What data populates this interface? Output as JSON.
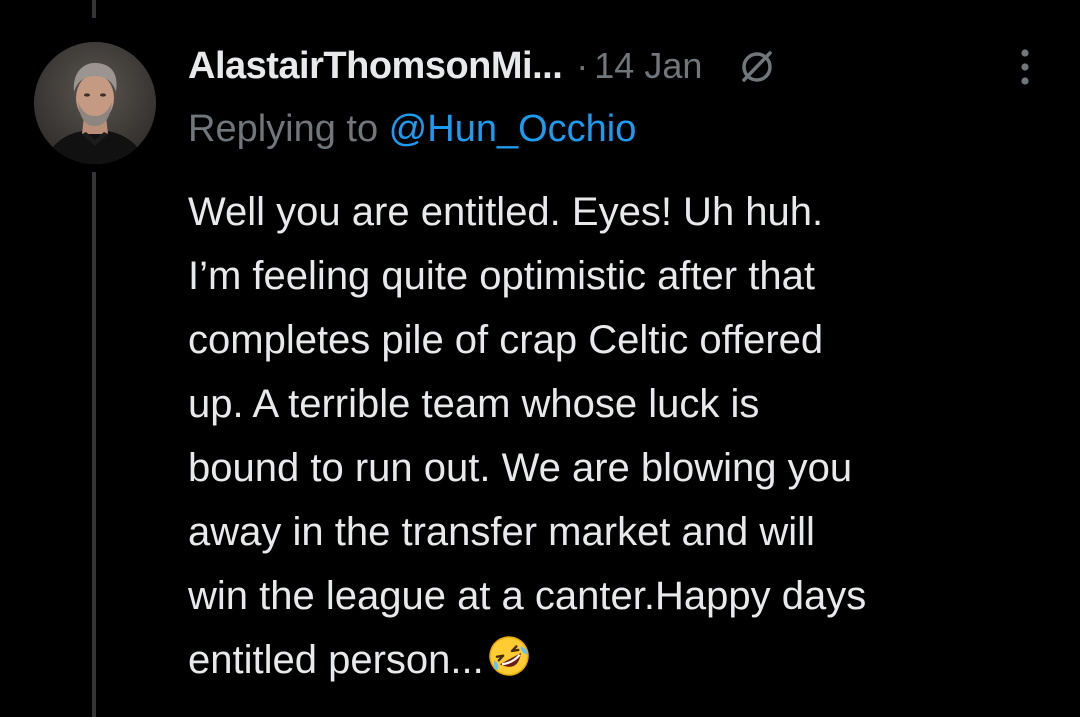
{
  "tweet": {
    "author": {
      "display_name": "AlastairThomsonMi...",
      "avatar": "avatar-photo"
    },
    "separator": "·",
    "date": "14 Jan",
    "icons": {
      "edited": "slashed-circle-icon",
      "more": "more-vertical-icon"
    },
    "replying_to": {
      "prefix": "Replying to ",
      "handle": "@Hun_Occhio"
    },
    "text_lines": [
      "Well you are entitled. Eyes! Uh huh.",
      "I’m feeling quite optimistic after that",
      "completes pile of crap Celtic offered",
      "up. A terrible team whose luck is",
      "bound to run out. We are blowing you",
      "away in the transfer market and will",
      "win the league at a canter.Happy days",
      "entitled person..."
    ],
    "trailing_emoji": "rolling-on-floor-laughing-emoji"
  },
  "colors": {
    "background": "#000000",
    "text": "#e7e9ea",
    "secondary": "#71767b",
    "link": "#1d9bf0",
    "thread_line": "#333639"
  }
}
